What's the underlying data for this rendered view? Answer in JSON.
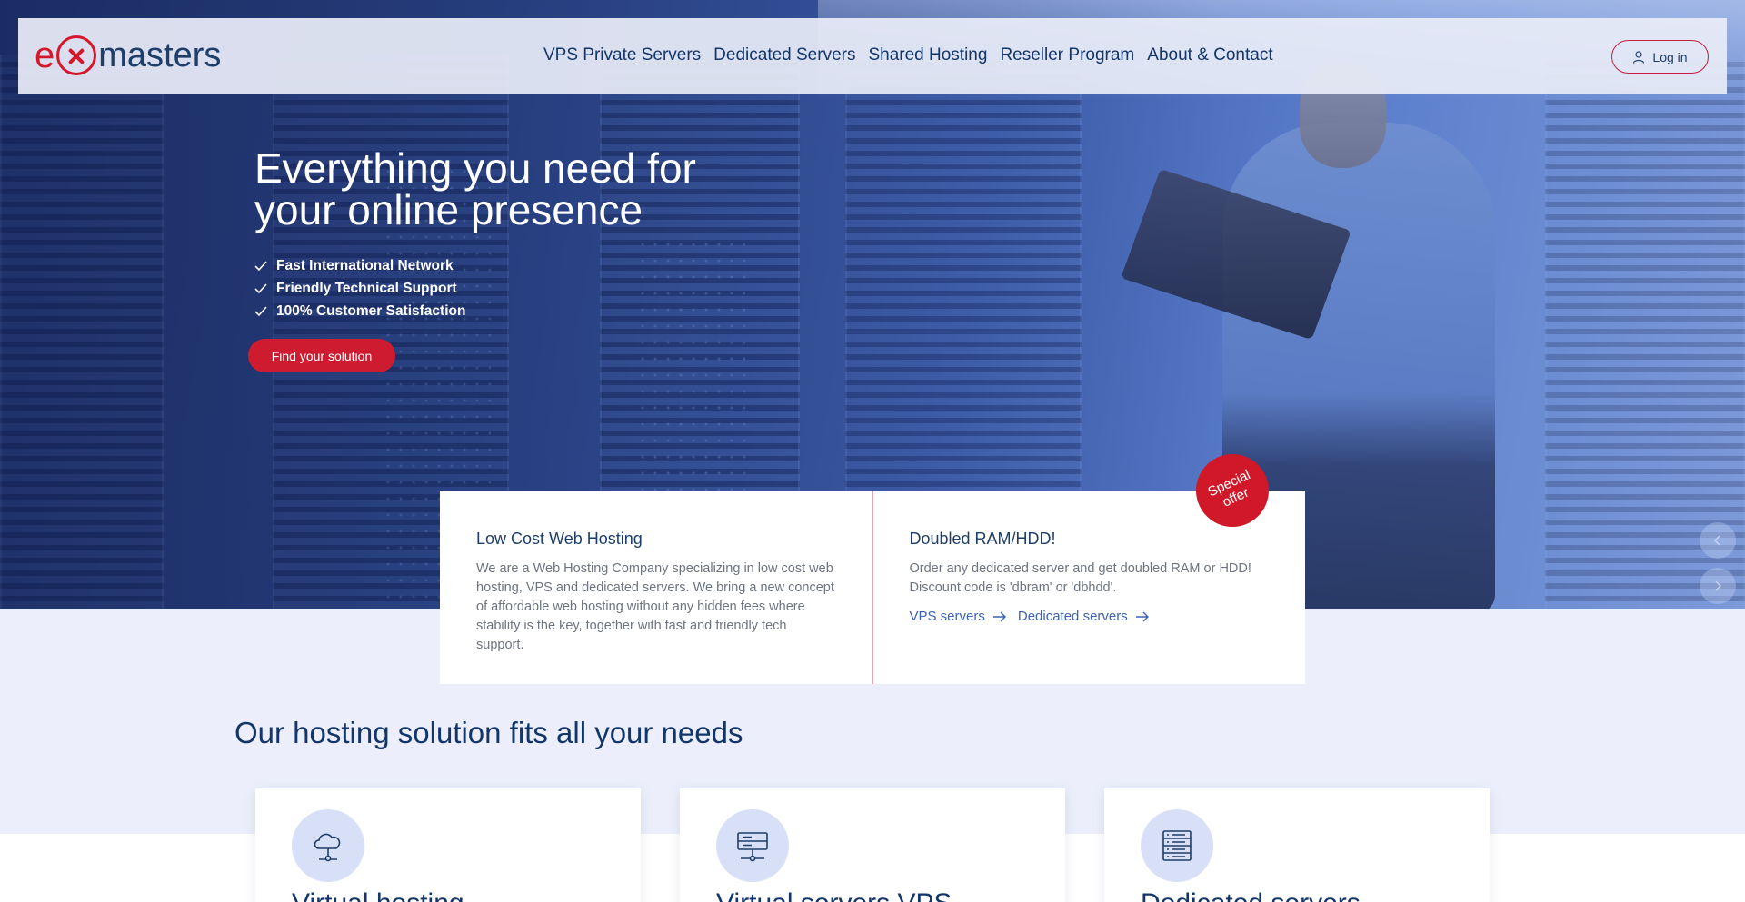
{
  "brand": {
    "logo_prefix": "e",
    "logo_name": "masters",
    "accent": "#d4172a",
    "primary": "#12356a"
  },
  "nav": {
    "items": [
      "VPS Private Servers",
      "Dedicated Servers",
      "Shared Hosting",
      "Reseller Program",
      "About & Contact"
    ],
    "login_label": "Log in"
  },
  "hero": {
    "title": "Everything you need for your online presence",
    "features": [
      "Fast International Network",
      "Friendly Technical Support",
      "100% Customer Satisfaction"
    ],
    "cta_label": "Find your solution"
  },
  "info": {
    "left": {
      "title": "Low Cost Web Hosting",
      "text": "We are a Web Hosting Company specializing in low cost web hosting, VPS and dedicated servers. We bring a new concept of affordable web hosting without any hidden fees where stability is the key, together with fast and friendly tech support."
    },
    "right": {
      "title": "Doubled RAM/HDD!",
      "text": "Order any dedicated server and get doubled RAM or HDD! Discount code is 'dbram' or 'dbhdd'.",
      "links": [
        "VPS servers",
        "Dedicated servers"
      ],
      "badge": "Special offer"
    }
  },
  "solutions": {
    "title": "Our hosting solution fits all your needs",
    "cards": [
      {
        "title": "Virtual hosting",
        "icon": "cloud-network-icon"
      },
      {
        "title": "Virtual servers VPS",
        "icon": "server-network-icon"
      },
      {
        "title": "Dedicated servers",
        "icon": "server-rack-icon"
      }
    ]
  }
}
